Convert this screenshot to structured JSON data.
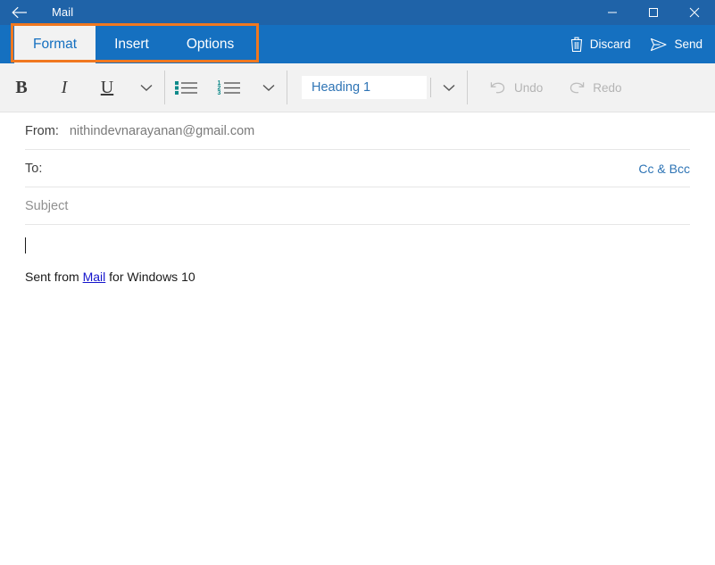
{
  "window": {
    "title": "Mail",
    "back_icon": "back-arrow-icon",
    "minimize_icon": "minimize-icon",
    "maximize_icon": "maximize-icon",
    "close_icon": "close-icon",
    "titlebar_color": "#1F63A8"
  },
  "ribbon": {
    "bar_color": "#1570C0",
    "active_tab_bg": "#F2F2F2",
    "active_tab_text_color": "#1570C0",
    "tabs": [
      {
        "label": "Format",
        "active": true
      },
      {
        "label": "Insert",
        "active": false
      },
      {
        "label": "Options",
        "active": false
      }
    ],
    "actions": [
      {
        "label": "Discard",
        "icon": "trash-icon"
      },
      {
        "label": "Send",
        "icon": "send-paper-plane-icon"
      }
    ]
  },
  "annotation": {
    "type": "highlight-rectangle",
    "color": "#F07820",
    "target": "ribbon-tabs"
  },
  "toolbar": {
    "background": "#F2F2F2",
    "bold_label": "B",
    "italic_label": "I",
    "underline_label": "U",
    "font_more_icon": "chevron-down-icon",
    "bullet_list_icon": "bulleted-list-icon",
    "numbered_list_icon": "numbered-list-icon",
    "list_more_icon": "chevron-down-icon",
    "list_accent_color": "#0E8A8A",
    "style_value": "Heading 1",
    "style_text_color": "#2E74B5",
    "style_more_icon": "chevron-down-icon",
    "undo_label": "Undo",
    "undo_icon": "undo-arrow-icon",
    "undo_disabled": true,
    "redo_label": "Redo",
    "redo_icon": "redo-arrow-icon",
    "redo_disabled": true,
    "disabled_color": "#B4B4B4"
  },
  "compose": {
    "from_label": "From:",
    "from_value": "nithindevnarayanan@gmail.com",
    "to_label": "To:",
    "to_value": "",
    "cc_bcc_label": "Cc & Bcc",
    "cc_bcc_color": "#2E74B5",
    "subject_placeholder": "Subject",
    "body_value": "",
    "signature_prefix": "Sent from ",
    "signature_link": "Mail",
    "signature_suffix": " for Windows 10",
    "signature_link_color": "#1414CC"
  }
}
